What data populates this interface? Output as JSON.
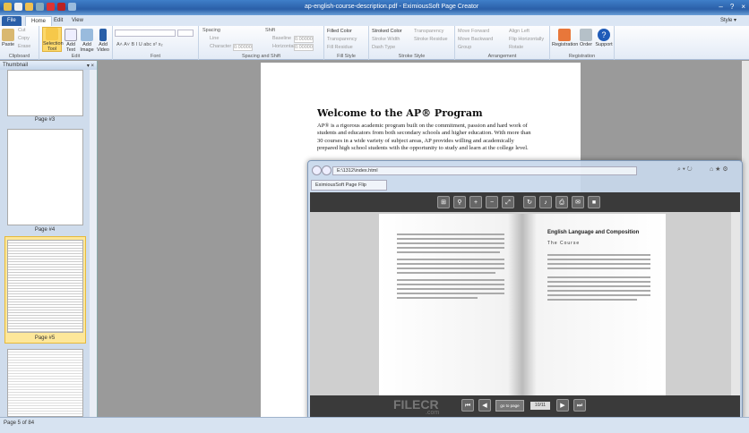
{
  "window": {
    "title": "ap-english-course-description.pdf - EximiousSoft Page Creator",
    "controls": [
      "–",
      "?",
      "×"
    ]
  },
  "tabs": [
    "File",
    "Home",
    "Edit",
    "View"
  ],
  "style_menu": "Style ▾",
  "ribbon": {
    "clipboard": {
      "label": "Clipboard",
      "paste": "Paste",
      "cut": "Cut",
      "copy": "Copy",
      "erase": "Erase"
    },
    "edit": {
      "label": "Edit",
      "selection": "Selection Tool",
      "add_text": "Add Text",
      "add_image": "Add Image",
      "add_video": "Add Video"
    },
    "font": {
      "label": "Font",
      "tools": "A˄ A˅  B  I  U  abc  x²  x₂"
    },
    "spacing": {
      "label": "Spacing and Shift",
      "spacing": "Spacing",
      "line": "Line",
      "character": "Character",
      "char_val": "0.00000",
      "shift": "Shift",
      "baseline": "Baseline",
      "baseline_val": "0.00000",
      "horizontal": "Horizontal",
      "horizontal_val": "0.00000"
    },
    "fill": {
      "label": "Fill Style",
      "filled_color": "Filled Color",
      "transparency": "Transparency",
      "fill_residue": "Fill Residue"
    },
    "stroke": {
      "label": "Stroke Style",
      "stroked_color": "Stroked Color",
      "transparency": "Transparency",
      "stroke_width": "Stroke Width",
      "stroke_residue": "Stroke Residue",
      "dash_type": "Dash Type"
    },
    "arrangement": {
      "label": "Arrangement",
      "move_forward": "Move Forward",
      "move_backward": "Move Backward",
      "group": "Group",
      "align_left": "Align Left",
      "flip_horizontally": "Flip Horizontally",
      "rotate": "Rotate"
    },
    "registration": {
      "label": "Registration",
      "registration": "Registration",
      "order": "Order",
      "support": "Support"
    }
  },
  "thumbnail": {
    "title": "Thumbnail",
    "pages": [
      {
        "label": "Page #3"
      },
      {
        "label": "Page #4"
      },
      {
        "label": "Page #5"
      }
    ]
  },
  "document": {
    "heading": "Welcome to the AP® Program",
    "body": "AP® is a rigorous academic program built on the commitment, passion and hard work of students and educators from both secondary schools and higher education. With more than 30 courses in a wide variety of subject areas, AP provides willing and academically prepared high school students with the opportunity to study and learn at the college level."
  },
  "browser": {
    "address": "E:\\1312\\index.html",
    "tab": "EximiousSoft Page Flip",
    "right_heading": "English Language and Composition",
    "right_sub": "The Course",
    "go_to_page": "go to page",
    "page_number": "10/11",
    "watermark": "FILECR",
    "watermark_sub": ".com"
  },
  "status": "Page 5 of 84"
}
